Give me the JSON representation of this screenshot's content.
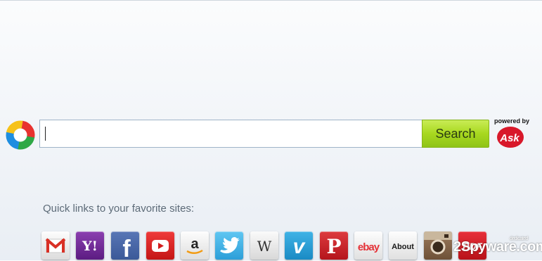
{
  "search": {
    "button_label": "Search",
    "input_value": "",
    "placeholder": ""
  },
  "brand": {
    "powered_by": "powered by",
    "ask_label": "Ask"
  },
  "quick_links": {
    "title": "Quick links to your favorite sites:",
    "items": [
      {
        "name": "gmail",
        "icon": "gmail-icon"
      },
      {
        "name": "yahoo",
        "icon": "yahoo-icon",
        "label": "Y!"
      },
      {
        "name": "facebook",
        "icon": "facebook-icon",
        "label": "f"
      },
      {
        "name": "youtube",
        "icon": "youtube-icon"
      },
      {
        "name": "amazon",
        "icon": "amazon-icon",
        "label": "a"
      },
      {
        "name": "twitter",
        "icon": "twitter-icon"
      },
      {
        "name": "wikipedia",
        "icon": "wikipedia-icon",
        "label": "W"
      },
      {
        "name": "vimeo",
        "icon": "vimeo-icon",
        "label": "v"
      },
      {
        "name": "pinterest",
        "icon": "pinterest-icon",
        "label": "P"
      },
      {
        "name": "ebay",
        "icon": "ebay-icon",
        "label": "ebay"
      },
      {
        "name": "about",
        "icon": "about-icon",
        "label": "About"
      },
      {
        "name": "instagram",
        "icon": "instagram-icon"
      },
      {
        "name": "pdf",
        "icon": "pdf-icon",
        "label": "PDF"
      }
    ]
  },
  "watermark": {
    "main": "2Spyware.com",
    "sub": "dedicated"
  },
  "colors": {
    "search_button": "#a8d81f",
    "input_border": "#9fb4c8",
    "ask_red": "#d8182a"
  }
}
